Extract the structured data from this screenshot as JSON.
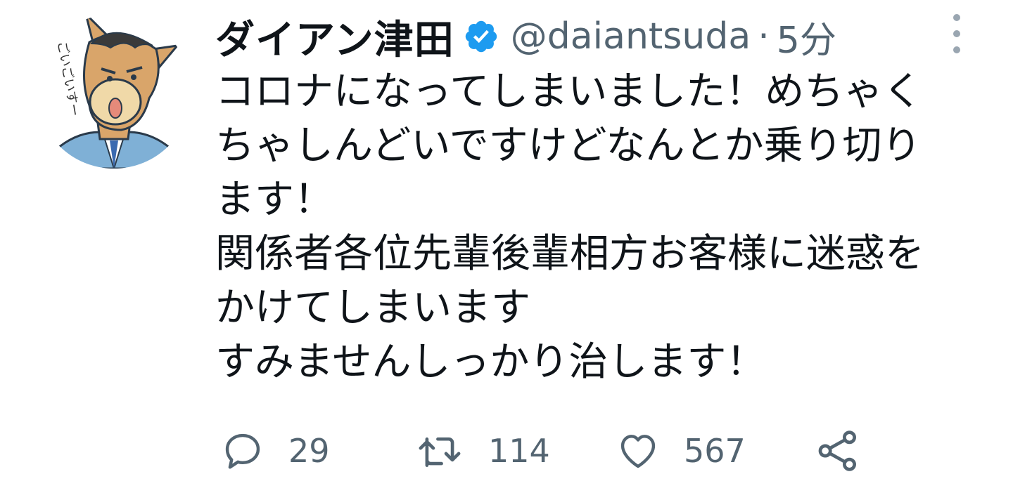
{
  "user": {
    "display_name": "ダイアン津田",
    "handle": "@daiantsuda",
    "separator": "·",
    "time": "5分",
    "verified": true,
    "avatar_text": "ごいごいすー"
  },
  "tweet": {
    "lines": [
      "コロナになってしまいました！めちゃく",
      "ちゃしんどいですけどなんとか乗り切り",
      "ます！",
      "関係者各位先輩後輩相方お客様に迷惑を",
      "かけてしまいます",
      "すみませんしっかり治します！"
    ]
  },
  "actions": {
    "reply": {
      "icon": "reply-icon",
      "count": "29"
    },
    "retweet": {
      "icon": "retweet-icon",
      "count": "114"
    },
    "like": {
      "icon": "heart-icon",
      "count": "567"
    },
    "share": {
      "icon": "share-icon"
    }
  },
  "colors": {
    "text": "#0f1419",
    "secondary": "#536471",
    "verified": "#1d9bf0",
    "icon": "#536471"
  }
}
